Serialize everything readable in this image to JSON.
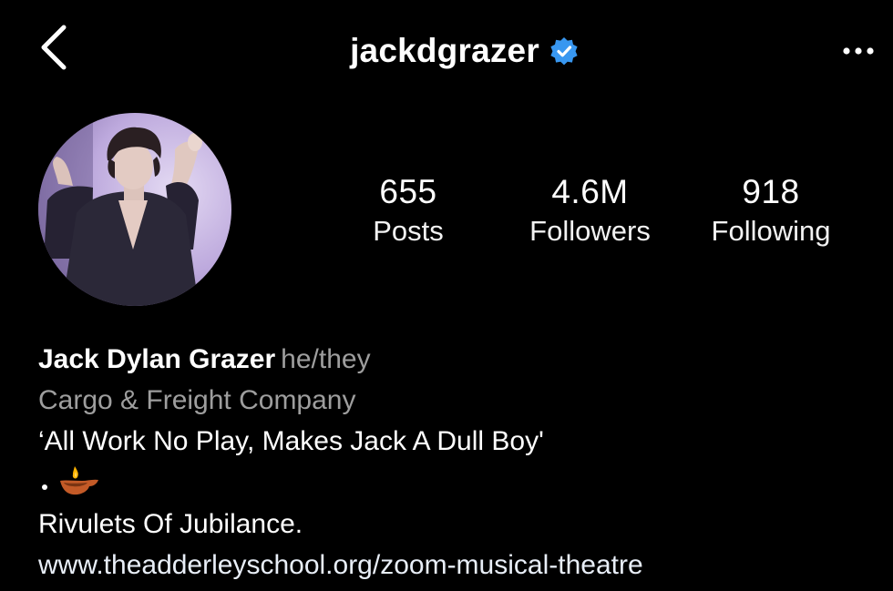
{
  "header": {
    "username": "jackdgrazer",
    "verified": true,
    "back_icon": "chevron-left-icon",
    "more_icon": "more-horizontal-icon"
  },
  "stats": {
    "posts": {
      "value": "655",
      "label": "Posts"
    },
    "followers": {
      "value": "4.6M",
      "label": "Followers"
    },
    "following": {
      "value": "918",
      "label": "Following"
    }
  },
  "bio": {
    "name": "Jack Dylan Grazer",
    "pronouns": "he/they",
    "category": "Cargo & Freight Company",
    "line1": "‘All Work No Play, Makes Jack A Dull Boy'",
    "emoji_line": "oil-lamp-emoji",
    "line2": "Rivulets Of Jubilance.",
    "link": "www.theadderleyschool.org/zoom-musical-theatre"
  },
  "colors": {
    "background": "#000000",
    "text": "#ffffff",
    "secondary": "#9e9e9e",
    "verified": "#3897f0"
  }
}
